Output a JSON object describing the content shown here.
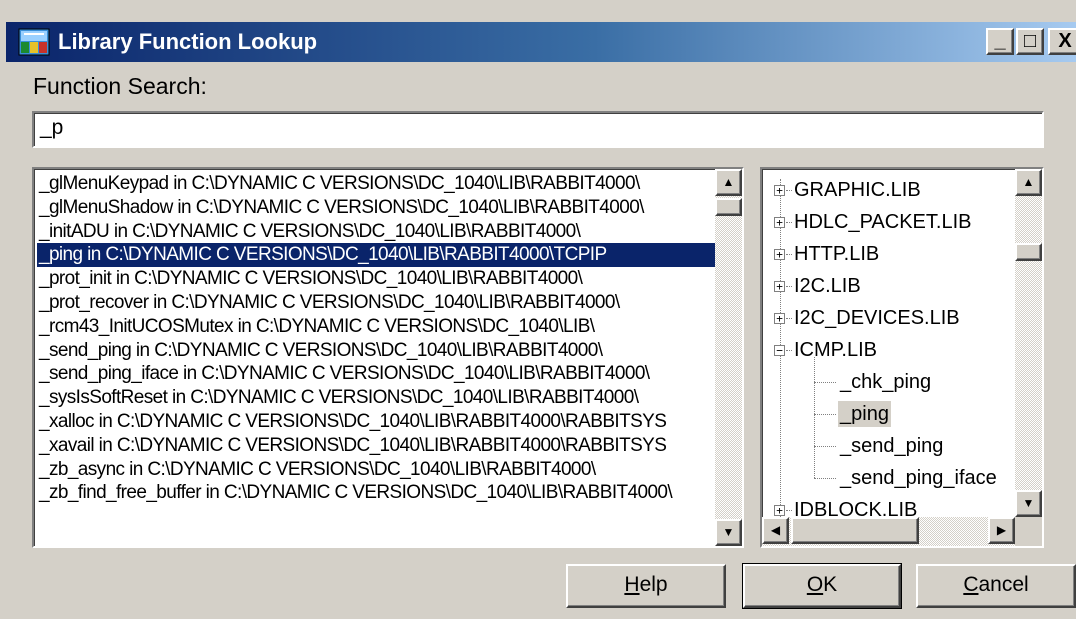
{
  "window": {
    "title": "Library Function Lookup",
    "controls": {
      "minimize": "_",
      "maximize": "□",
      "close": "X"
    }
  },
  "search": {
    "label": "Function Search:",
    "value": "_p"
  },
  "results": {
    "items": [
      "_glMenuKeypad in C:\\DYNAMIC C VERSIONS\\DC_1040\\LIB\\RABBIT4000\\",
      "_glMenuShadow in C:\\DYNAMIC C VERSIONS\\DC_1040\\LIB\\RABBIT4000\\",
      "_initADU in C:\\DYNAMIC C VERSIONS\\DC_1040\\LIB\\RABBIT4000\\",
      "_ping in C:\\DYNAMIC C VERSIONS\\DC_1040\\LIB\\RABBIT4000\\TCPIP",
      "_prot_init in C:\\DYNAMIC C VERSIONS\\DC_1040\\LIB\\RABBIT4000\\",
      "_prot_recover in C:\\DYNAMIC C VERSIONS\\DC_1040\\LIB\\RABBIT4000\\",
      "_rcm43_InitUCOSMutex in C:\\DYNAMIC C VERSIONS\\DC_1040\\LIB\\",
      "_send_ping in C:\\DYNAMIC C VERSIONS\\DC_1040\\LIB\\RABBIT4000\\",
      "_send_ping_iface in C:\\DYNAMIC C VERSIONS\\DC_1040\\LIB\\RABBIT4000\\",
      "_sysIsSoftReset in C:\\DYNAMIC C VERSIONS\\DC_1040\\LIB\\RABBIT4000\\",
      "_xalloc in C:\\DYNAMIC C VERSIONS\\DC_1040\\LIB\\RABBIT4000\\RABBITSYS",
      "_xavail in C:\\DYNAMIC C VERSIONS\\DC_1040\\LIB\\RABBIT4000\\RABBITSYS",
      "_zb_async in C:\\DYNAMIC C VERSIONS\\DC_1040\\LIB\\RABBIT4000\\",
      "_zb_find_free_buffer in C:\\DYNAMIC C VERSIONS\\DC_1040\\LIB\\RABBIT4000\\"
    ],
    "selected_index": 3
  },
  "tree": {
    "libraries": [
      {
        "label": "GRAPHIC.LIB",
        "expander": "+"
      },
      {
        "label": "HDLC_PACKET.LIB",
        "expander": "+"
      },
      {
        "label": "HTTP.LIB",
        "expander": "+"
      },
      {
        "label": "I2C.LIB",
        "expander": "+"
      },
      {
        "label": "I2C_DEVICES.LIB",
        "expander": "+"
      },
      {
        "label": "ICMP.LIB",
        "expander": "−"
      },
      {
        "label": "IDBLOCK.LIB",
        "expander": "+"
      }
    ],
    "icmp_children": [
      "_chk_ping",
      "_ping",
      "_send_ping",
      "_send_ping_iface"
    ],
    "selected_child": "_ping"
  },
  "scroll_arrows": {
    "up": "▲",
    "down": "▼",
    "left": "◀",
    "right": "▶"
  },
  "buttons": {
    "help": {
      "mnemonic": "H",
      "rest": "elp"
    },
    "ok": {
      "mnemonic": "O",
      "rest": "K"
    },
    "cancel": {
      "mnemonic": "C",
      "rest": "ancel"
    }
  }
}
